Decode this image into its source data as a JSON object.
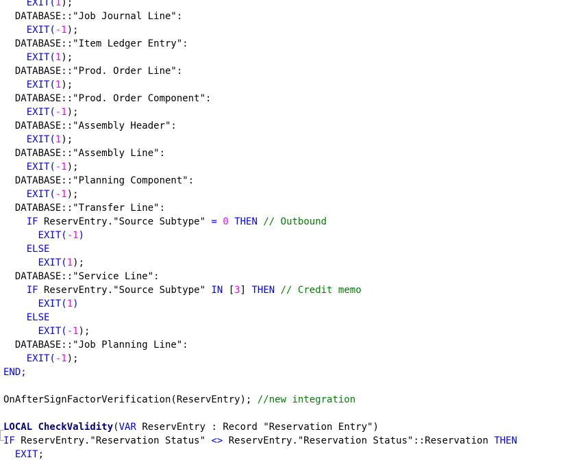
{
  "code": {
    "lines": [
      [
        {
          "t": "    ",
          "c": "id"
        },
        {
          "t": "EXIT(",
          "c": "kw"
        },
        {
          "t": "1",
          "c": "num"
        },
        {
          "t": ");",
          "c": "id"
        }
      ],
      [
        {
          "t": "  DATABASE::\"Job Journal Line\":",
          "c": "id"
        }
      ],
      [
        {
          "t": "    ",
          "c": "id"
        },
        {
          "t": "EXIT(",
          "c": "kw"
        },
        {
          "t": "-1",
          "c": "num"
        },
        {
          "t": ");",
          "c": "id"
        }
      ],
      [
        {
          "t": "  DATABASE::\"Item Ledger Entry\":",
          "c": "id"
        }
      ],
      [
        {
          "t": "    ",
          "c": "id"
        },
        {
          "t": "EXIT(",
          "c": "kw"
        },
        {
          "t": "1",
          "c": "num"
        },
        {
          "t": ");",
          "c": "id"
        }
      ],
      [
        {
          "t": "  DATABASE::\"Prod. Order Line\":",
          "c": "id"
        }
      ],
      [
        {
          "t": "    ",
          "c": "id"
        },
        {
          "t": "EXIT(",
          "c": "kw"
        },
        {
          "t": "1",
          "c": "num"
        },
        {
          "t": ");",
          "c": "id"
        }
      ],
      [
        {
          "t": "  DATABASE::\"Prod. Order Component\":",
          "c": "id"
        }
      ],
      [
        {
          "t": "    ",
          "c": "id"
        },
        {
          "t": "EXIT(",
          "c": "kw"
        },
        {
          "t": "-1",
          "c": "num"
        },
        {
          "t": ");",
          "c": "id"
        }
      ],
      [
        {
          "t": "  DATABASE::\"Assembly Header\":",
          "c": "id"
        }
      ],
      [
        {
          "t": "    ",
          "c": "id"
        },
        {
          "t": "EXIT(",
          "c": "kw"
        },
        {
          "t": "1",
          "c": "num"
        },
        {
          "t": ");",
          "c": "id"
        }
      ],
      [
        {
          "t": "  DATABASE::\"Assembly Line\":",
          "c": "id"
        }
      ],
      [
        {
          "t": "    ",
          "c": "id"
        },
        {
          "t": "EXIT(",
          "c": "kw"
        },
        {
          "t": "-1",
          "c": "num"
        },
        {
          "t": ");",
          "c": "id"
        }
      ],
      [
        {
          "t": "  DATABASE::\"Planning Component\":",
          "c": "id"
        }
      ],
      [
        {
          "t": "    ",
          "c": "id"
        },
        {
          "t": "EXIT(",
          "c": "kw"
        },
        {
          "t": "-1",
          "c": "num"
        },
        {
          "t": ");",
          "c": "id"
        }
      ],
      [
        {
          "t": "  DATABASE::\"Transfer Line\":",
          "c": "id"
        }
      ],
      [
        {
          "t": "    ",
          "c": "id"
        },
        {
          "t": "IF",
          "c": "kw"
        },
        {
          "t": " ReservEntry.\"Source Subtype\" ",
          "c": "id"
        },
        {
          "t": "=",
          "c": "kw"
        },
        {
          "t": " ",
          "c": "id"
        },
        {
          "t": "0",
          "c": "num"
        },
        {
          "t": " ",
          "c": "id"
        },
        {
          "t": "THEN",
          "c": "kw"
        },
        {
          "t": " ",
          "c": "id"
        },
        {
          "t": "// Outbound",
          "c": "cmt"
        }
      ],
      [
        {
          "t": "      ",
          "c": "id"
        },
        {
          "t": "EXIT(",
          "c": "kw"
        },
        {
          "t": "-1",
          "c": "num"
        },
        {
          "t": ")",
          "c": "kw"
        }
      ],
      [
        {
          "t": "    ",
          "c": "id"
        },
        {
          "t": "ELSE",
          "c": "kw"
        }
      ],
      [
        {
          "t": "      ",
          "c": "id"
        },
        {
          "t": "EXIT(",
          "c": "kw"
        },
        {
          "t": "1",
          "c": "num"
        },
        {
          "t": ");",
          "c": "id"
        }
      ],
      [
        {
          "t": "  DATABASE::\"Service Line\":",
          "c": "id"
        }
      ],
      [
        {
          "t": "    ",
          "c": "id"
        },
        {
          "t": "IF",
          "c": "kw"
        },
        {
          "t": " ReservEntry.\"Source Subtype\" ",
          "c": "id"
        },
        {
          "t": "IN",
          "c": "kw"
        },
        {
          "t": " [",
          "c": "id"
        },
        {
          "t": "3",
          "c": "num"
        },
        {
          "t": "] ",
          "c": "id"
        },
        {
          "t": "THEN",
          "c": "kw"
        },
        {
          "t": " ",
          "c": "id"
        },
        {
          "t": "// Credit memo",
          "c": "cmt"
        }
      ],
      [
        {
          "t": "      ",
          "c": "id"
        },
        {
          "t": "EXIT(",
          "c": "kw"
        },
        {
          "t": "1",
          "c": "num"
        },
        {
          "t": ")",
          "c": "kw"
        }
      ],
      [
        {
          "t": "    ",
          "c": "id"
        },
        {
          "t": "ELSE",
          "c": "kw"
        }
      ],
      [
        {
          "t": "      ",
          "c": "id"
        },
        {
          "t": "EXIT(",
          "c": "kw"
        },
        {
          "t": "-1",
          "c": "num"
        },
        {
          "t": ");",
          "c": "id"
        }
      ],
      [
        {
          "t": "  DATABASE::\"Job Planning Line\":",
          "c": "id"
        }
      ],
      [
        {
          "t": "    ",
          "c": "id"
        },
        {
          "t": "EXIT(",
          "c": "kw"
        },
        {
          "t": "-1",
          "c": "num"
        },
        {
          "t": ");",
          "c": "id"
        }
      ],
      [
        {
          "t": "END;",
          "c": "kw"
        }
      ],
      [
        {
          "t": "",
          "c": "id"
        }
      ],
      [
        {
          "t": "OnAfterSignFactorVerification(ReservEntry); ",
          "c": "id"
        },
        {
          "t": "//new integration",
          "c": "cmt"
        }
      ],
      [
        {
          "t": "",
          "c": "id"
        }
      ],
      [
        {
          "t": "LOCAL ",
          "c": "fn"
        },
        {
          "t": "CheckValidity",
          "c": "fn"
        },
        {
          "t": "(",
          "c": "id"
        },
        {
          "t": "VAR",
          "c": "kw"
        },
        {
          "t": " ReservEntry : Record \"Reservation Entry\")",
          "c": "id"
        }
      ],
      [
        {
          "t": "IF",
          "c": "kw"
        },
        {
          "t": " ReservEntry.\"Reservation Status\" ",
          "c": "id"
        },
        {
          "t": "<>",
          "c": "kw"
        },
        {
          "t": " ReservEntry.\"Reservation Status\"::Reservation ",
          "c": "id"
        },
        {
          "t": "THEN",
          "c": "kw"
        }
      ],
      [
        {
          "t": "  ",
          "c": "id"
        },
        {
          "t": "EXIT",
          "c": "kw"
        },
        {
          "t": ";",
          "c": "id"
        }
      ]
    ]
  }
}
